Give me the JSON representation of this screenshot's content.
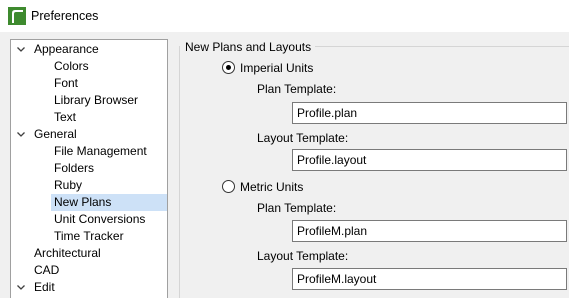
{
  "window": {
    "title": "Preferences",
    "icon": "app-logo-icon",
    "accent_color": "#3e8a2e"
  },
  "tree": {
    "items": [
      {
        "label": "Appearance",
        "level": 0,
        "expanded": true
      },
      {
        "label": "Colors",
        "level": 1
      },
      {
        "label": "Font",
        "level": 1
      },
      {
        "label": "Library Browser",
        "level": 1
      },
      {
        "label": "Text",
        "level": 1
      },
      {
        "label": "General",
        "level": 0,
        "expanded": true
      },
      {
        "label": "File Management",
        "level": 1
      },
      {
        "label": "Folders",
        "level": 1
      },
      {
        "label": "Ruby",
        "level": 1
      },
      {
        "label": "New Plans",
        "level": 1,
        "selected": true
      },
      {
        "label": "Unit Conversions",
        "level": 1
      },
      {
        "label": "Time Tracker",
        "level": 1
      },
      {
        "label": "Architectural",
        "level": 0
      },
      {
        "label": "CAD",
        "level": 0
      },
      {
        "label": "Edit",
        "level": 0,
        "expanded": true
      }
    ],
    "selected_color": "#cde1f7"
  },
  "panel": {
    "group_title": "New Plans and Layouts",
    "imperial": {
      "label": "Imperial Units",
      "checked": true,
      "plan_template_label": "Plan Template:",
      "plan_template_value": "Profile.plan",
      "layout_template_label": "Layout Template:",
      "layout_template_value": "Profile.layout"
    },
    "metric": {
      "label": "Metric Units",
      "checked": false,
      "plan_template_label": "Plan Template:",
      "plan_template_value": "ProfileM.plan",
      "layout_template_label": "Layout Template:",
      "layout_template_value": "ProfileM.layout"
    }
  }
}
